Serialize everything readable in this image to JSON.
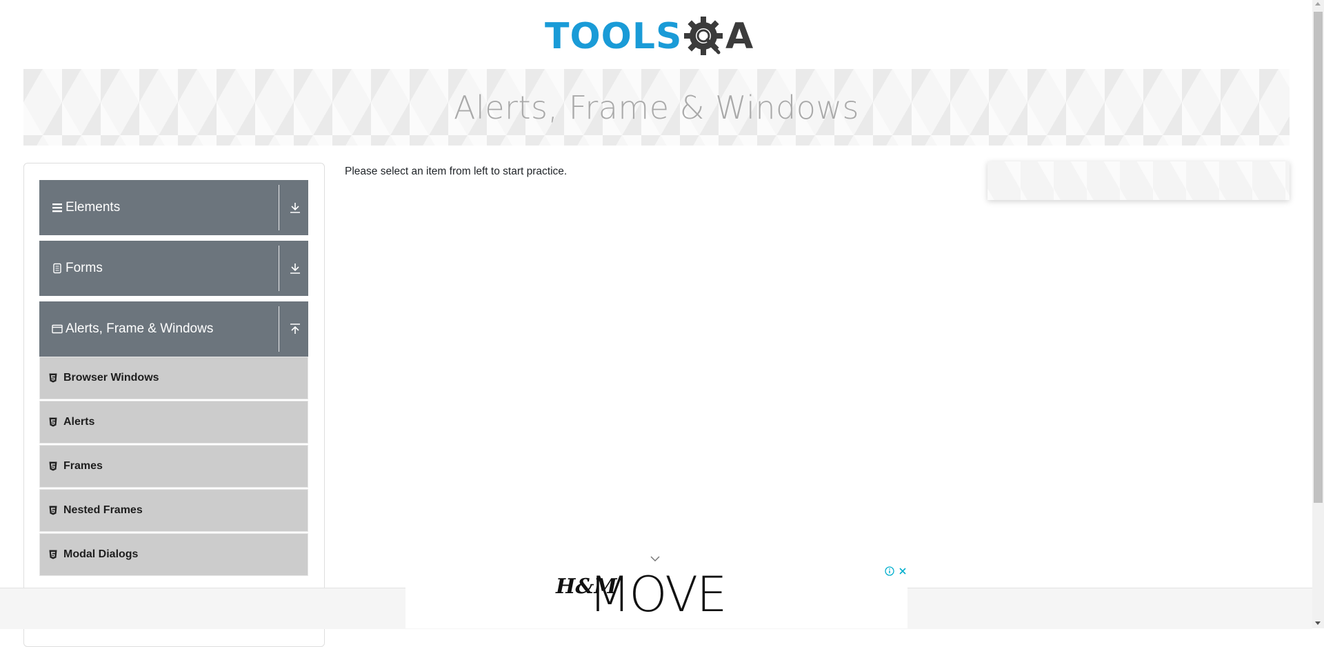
{
  "header": {
    "logo_part_1": "TOOLS",
    "logo_part_2": "QA"
  },
  "banner": {
    "title": "Alerts, Frame & Windows"
  },
  "sidebar": {
    "groups": [
      {
        "label": "Elements",
        "icon": "hamburger-icon",
        "state": "collapsed",
        "arrow_icon": "download-arrow-icon"
      },
      {
        "label": "Forms",
        "icon": "document-icon",
        "state": "collapsed",
        "arrow_icon": "download-arrow-icon"
      },
      {
        "label": "Alerts, Frame & Windows",
        "icon": "window-icon",
        "state": "expanded",
        "arrow_icon": "upload-arrow-icon"
      }
    ],
    "items": [
      {
        "label": "Browser Windows",
        "icon": "html5-icon"
      },
      {
        "label": "Alerts",
        "icon": "html5-icon"
      },
      {
        "label": "Frames",
        "icon": "html5-icon"
      },
      {
        "label": "Nested Frames",
        "icon": "html5-icon"
      },
      {
        "label": "Modal Dialogs",
        "icon": "html5-icon"
      }
    ]
  },
  "main": {
    "message": "Please select an item from left to start practice."
  },
  "ad": {
    "brand": "H&M",
    "tagline": "MOVE",
    "info_icon": "info-icon",
    "close_icon": "close-icon",
    "collapse_icon": "chevron-down-icon"
  },
  "colors": {
    "accent_blue": "#1a9bd7",
    "group_bg": "#6c757d",
    "item_bg": "#cccccc",
    "banner_text": "#a9a9a9"
  }
}
